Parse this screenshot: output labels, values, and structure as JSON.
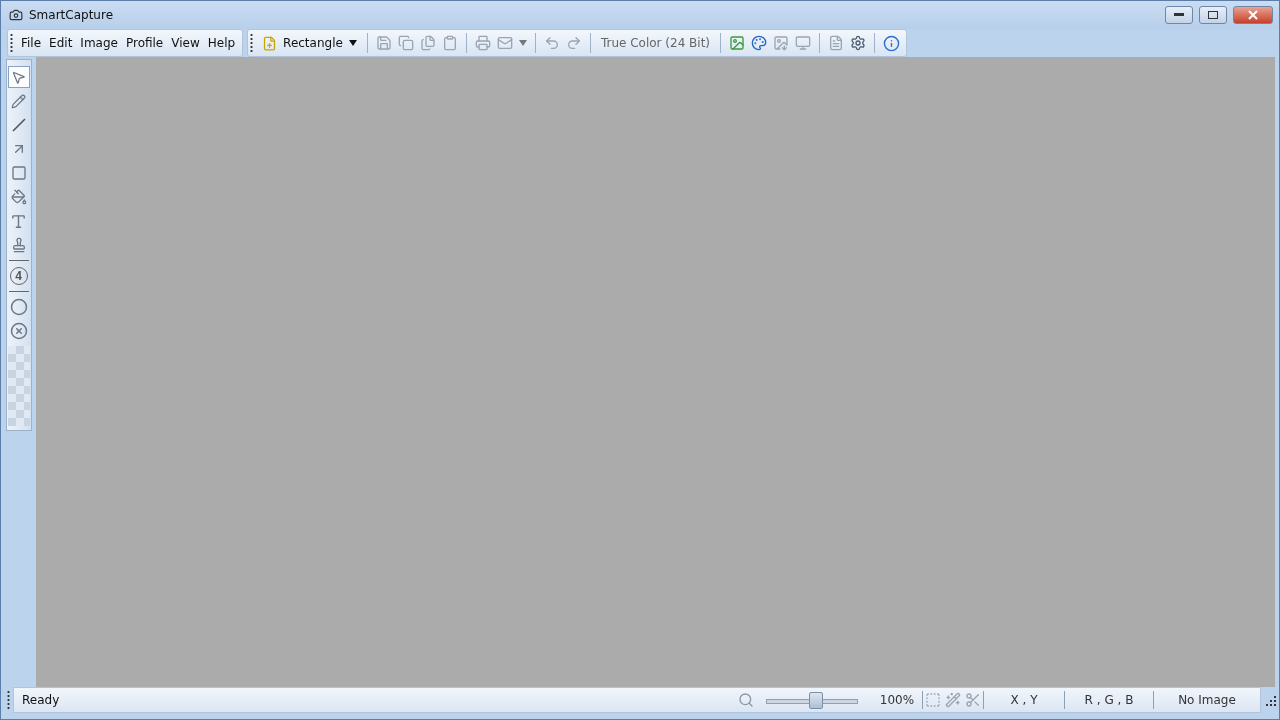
{
  "window": {
    "title": "SmartCapture"
  },
  "menu": [
    "File",
    "Edit",
    "Image",
    "Profile",
    "View",
    "Help"
  ],
  "toolbar": {
    "capture_mode": "Rectangle",
    "color_mode": "True Color (24 Bit)"
  },
  "tool_groups": [
    [
      {
        "kind": "select",
        "selected": true
      },
      {
        "kind": "pencil",
        "selected": false
      },
      {
        "kind": "line",
        "selected": false
      },
      {
        "kind": "arrow",
        "selected": false
      },
      {
        "kind": "rectangle",
        "selected": false
      },
      {
        "kind": "fill",
        "selected": false
      },
      {
        "kind": "text",
        "selected": false
      },
      {
        "kind": "stamp",
        "selected": false
      }
    ],
    [
      {
        "kind": "number",
        "label": "4",
        "selected": false
      }
    ],
    [
      {
        "kind": "ellipse",
        "selected": false
      },
      {
        "kind": "eraser",
        "selected": false
      }
    ]
  ],
  "status_bar": {
    "message": "Ready",
    "zoom": {
      "level": 0.54,
      "reading": "100%"
    },
    "coordinates": "X , Y",
    "color_value": "R , G , B",
    "image_info": "No Image"
  }
}
